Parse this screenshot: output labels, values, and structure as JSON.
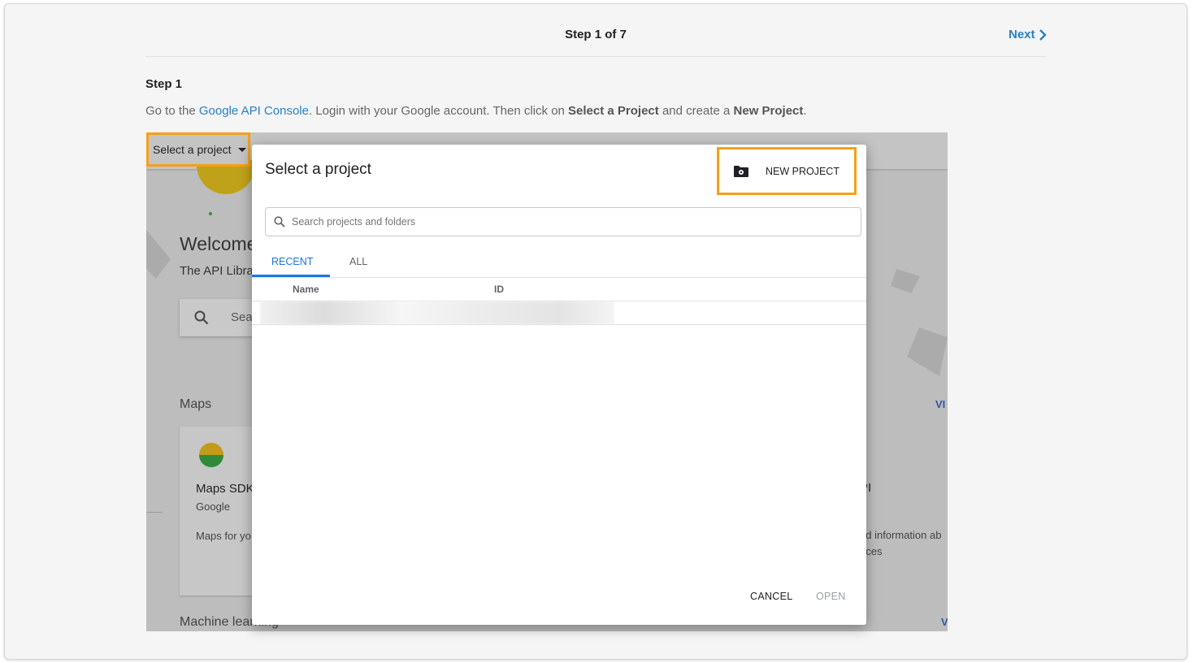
{
  "header": {
    "step_title": "Step 1 of 7",
    "next_label": "Next"
  },
  "step": {
    "label": "Step 1",
    "instr_prefix": "Go to the ",
    "instr_link": "Google API Console",
    "instr_mid1": ". Login with your Google account. Then click on ",
    "instr_bold1": "Select a Project",
    "instr_mid2": " and create a ",
    "instr_bold2": "New Project",
    "instr_end": "."
  },
  "screenshot_bg": {
    "select_project": "Select a project",
    "welcome": "Welcome",
    "api_library": "The API Libra",
    "search": "Sea",
    "maps": "Maps",
    "maps_sdk": "Maps SDK",
    "google": "Google",
    "maps_for": "Maps for yo",
    "machine_learning": "Machine learning",
    "view1": "VI",
    "view2": "V",
    "api_suffix": "PI",
    "info1": "ed information ab",
    "info2": "aces"
  },
  "dialog": {
    "title": "Select a project",
    "new_project_label": "NEW PROJECT",
    "search_placeholder": "Search projects and folders",
    "tabs": [
      "RECENT",
      "ALL"
    ],
    "active_tab": "RECENT",
    "columns": [
      "Name",
      "ID"
    ],
    "cancel_label": "CANCEL",
    "open_label": "OPEN"
  },
  "colors": {
    "accent_link": "#2a7fc0",
    "highlight_border": "#f5a01a",
    "tab_active": "#1a73e8"
  },
  "icons": [
    "chevron-right-icon",
    "caret-down-icon",
    "search-icon",
    "new-folder-icon"
  ]
}
